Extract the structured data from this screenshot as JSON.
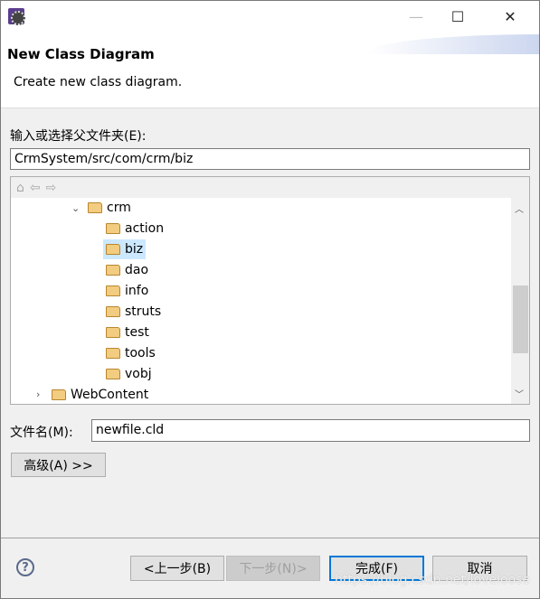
{
  "window": {
    "minimize": "—",
    "maximize": "☐",
    "close": "✕"
  },
  "header": {
    "title": "New Class Diagram",
    "description": "Create new class diagram."
  },
  "parent_folder": {
    "label": "输入或选择父文件夹(E):",
    "value": "CrmSystem/src/com/crm/biz"
  },
  "tree": {
    "toolbar": {
      "home": "⌂",
      "back": "⇦",
      "forward": "⇨"
    },
    "items": [
      {
        "label": "crm",
        "expanded": true,
        "level": 0
      },
      {
        "label": "action",
        "level": 1
      },
      {
        "label": "biz",
        "level": 1,
        "selected": true
      },
      {
        "label": "dao",
        "level": 1
      },
      {
        "label": "info",
        "level": 1
      },
      {
        "label": "struts",
        "level": 1
      },
      {
        "label": "test",
        "level": 1
      },
      {
        "label": "tools",
        "level": 1
      },
      {
        "label": "vobj",
        "level": 1
      },
      {
        "label": "WebContent",
        "expanded": false,
        "level": -1
      }
    ]
  },
  "file_name": {
    "label": "文件名(M):",
    "value": "newfile.cld"
  },
  "advanced_button": "高级(A) >>",
  "buttons": {
    "back": "<上一步(B)",
    "next": "下一步(N)>",
    "finish": "完成(F)",
    "cancel": "取消"
  },
  "help": "?",
  "watermark": "https://blog.csdn.net/loveloose",
  "colors": {
    "selection": "#cce8ff",
    "default_button_border": "#0078d7"
  }
}
